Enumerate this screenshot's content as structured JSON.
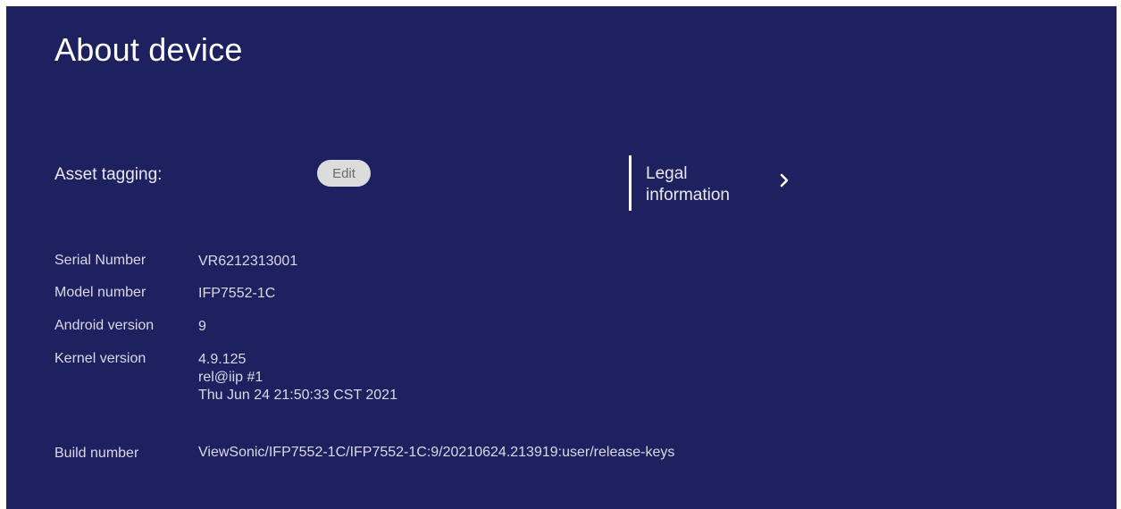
{
  "page": {
    "title": "About device"
  },
  "asset": {
    "label": "Asset tagging:",
    "edit_label": "Edit"
  },
  "legal": {
    "line1": "Legal",
    "line2": "information",
    "chevron_icon": "chevron-right-icon"
  },
  "info": {
    "serial": {
      "label": "Serial Number",
      "value": "VR6212313001"
    },
    "model": {
      "label": "Model number",
      "value": "IFP7552-1C"
    },
    "android": {
      "label": "Android version",
      "value": "9"
    },
    "kernel": {
      "label": "Kernel version",
      "lines": [
        "4.9.125",
        "rel@iip #1",
        "Thu Jun 24 21:50:33 CST 2021"
      ]
    },
    "build": {
      "label": "Build number",
      "value": "ViewSonic/IFP7552-1C/IFP7552-1C:9/20210624.213919:user/release-keys"
    }
  },
  "colors": {
    "background": "#1e2160",
    "text": "#ffffff",
    "button_bg": "#dcdcdc"
  }
}
